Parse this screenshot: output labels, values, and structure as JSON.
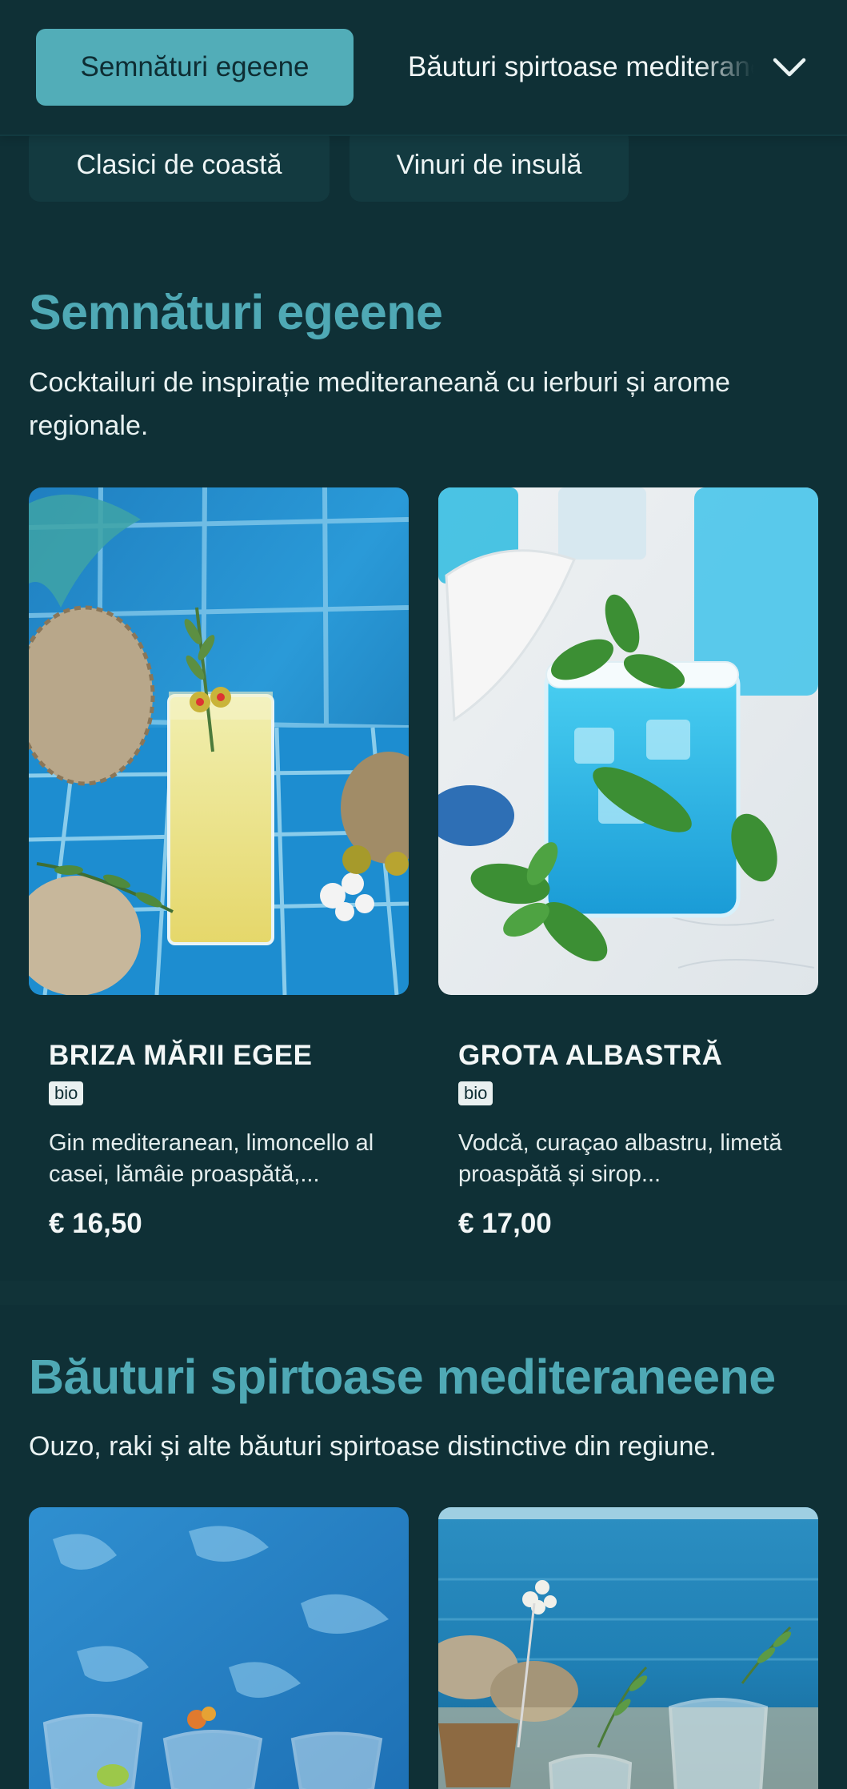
{
  "nav": {
    "active_tab": "Semnături egeene",
    "scroll_tab": "Băuturi spirtoase mediteraneene",
    "chips": [
      "Clasici de coastă",
      "Vinuri de insulă"
    ]
  },
  "sections": [
    {
      "title": "Semnături egeene",
      "description": "Cocktailuri de inspirație mediteraneană cu ierburi și arome regionale.",
      "products": [
        {
          "name": "BRIZA MĂRII EGEE",
          "badge": "bio",
          "description": "Gin mediteranean, limoncello al casei, lămâie proaspătă,...",
          "price": "€ 16,50"
        },
        {
          "name": "GROTA ALBASTRĂ",
          "badge": "bio",
          "description": "Vodcă, curaçao albastru, limetă proaspătă și sirop...",
          "price": "€ 17,00"
        }
      ]
    },
    {
      "title": "Băuturi spirtoase mediteraneene",
      "description": "Ouzo, raki și alte băuturi spirtoase distinctive din regiune."
    }
  ],
  "colors": {
    "background": "#0f3036",
    "accent": "#52adb8",
    "section_title": "#4fa9b5",
    "chip": "#133a40"
  },
  "icons": {
    "nav_expand": "chevron-down-icon"
  }
}
